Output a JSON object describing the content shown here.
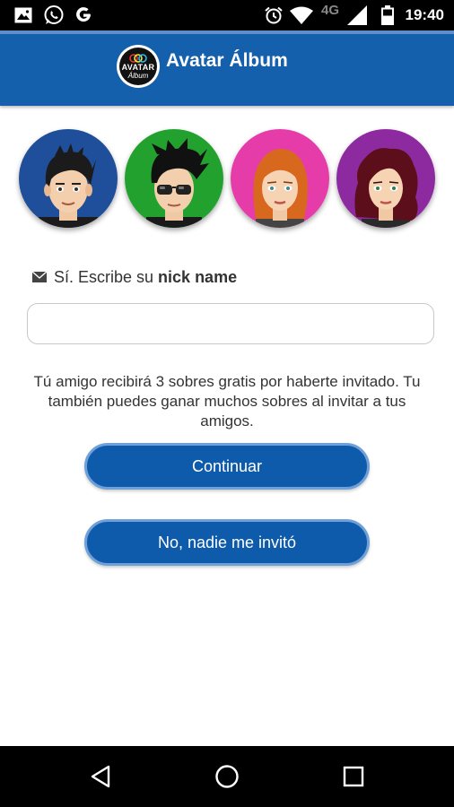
{
  "status_bar": {
    "time": "19:40",
    "network": "4G",
    "left_icons": [
      "image-icon",
      "whatsapp-icon",
      "google-icon"
    ],
    "right_icons": [
      "alarm-icon",
      "wifi-icon",
      "signal-icon",
      "battery-icon"
    ]
  },
  "app_bar": {
    "title": "Avatar Álbum",
    "logo_line1": "AVATAR",
    "logo_line2": "Álbum",
    "color": "#1460ad"
  },
  "avatars": [
    {
      "bg": "#1f4e9a",
      "hair": "black spiky",
      "gender": "male"
    },
    {
      "bg": "#22a12f",
      "hair": "black spiky",
      "glasses": "sunglasses",
      "gender": "male"
    },
    {
      "bg": "#e63caa",
      "hair": "orange",
      "gender": "female"
    },
    {
      "bg": "#8d2aa0",
      "hair": "dark red curly",
      "gender": "female"
    }
  ],
  "form": {
    "label_prefix": "Sí. Escribe su",
    "label_bold": "nick name",
    "nick_value": "",
    "nick_placeholder": ""
  },
  "info_text": "Tú amigo recibirá 3 sobres gratis por haberte invitado. Tu también puedes ganar muchos sobres al invitar a tus amigos.",
  "buttons": {
    "continue_label": "Continuar",
    "no_invite_label": "No, nadie me invitó",
    "color": "#0f5bab"
  },
  "nav_bar": {
    "items": [
      "back-icon",
      "home-icon",
      "recents-icon"
    ]
  }
}
